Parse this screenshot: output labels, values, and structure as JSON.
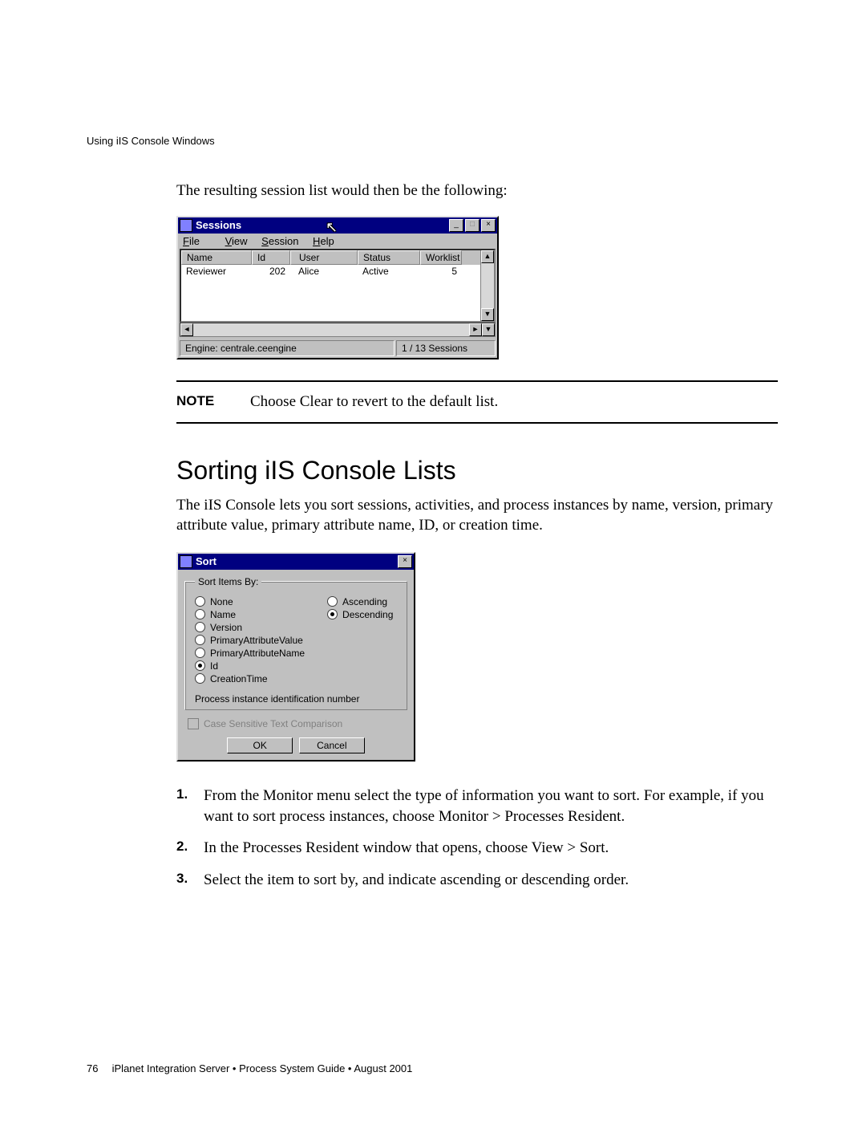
{
  "running_head": "Using iIS Console Windows",
  "intro1": "The resulting session list would then be the following:",
  "sessions_win": {
    "title": "Sessions",
    "menus": [
      "File",
      "View",
      "Session",
      "Help"
    ],
    "columns": [
      "Name",
      "Id",
      "User",
      "Status",
      "Worklist"
    ],
    "row": {
      "name": "Reviewer",
      "id": "202",
      "user": "Alice",
      "status": "Active",
      "worklist": "5"
    },
    "status_left": "Engine: centrale.ceengine",
    "status_right": "1 / 13 Sessions"
  },
  "note": {
    "label": "NOTE",
    "text": "Choose Clear to revert to the default list."
  },
  "section_title": "Sorting iIS Console Lists",
  "section_intro": "The iIS Console lets you sort sessions, activities, and process instances by name, version, primary attribute value, primary attribute name, ID, or creation time.",
  "sort_dlg": {
    "title": "Sort",
    "legend": "Sort Items By:",
    "fields": [
      "None",
      "Name",
      "Version",
      "PrimaryAttributeValue",
      "PrimaryAttributeName",
      "Id",
      "CreationTime"
    ],
    "selected_field": "Id",
    "order": [
      "Ascending",
      "Descending"
    ],
    "selected_order": "Descending",
    "desc": "Process instance identification number",
    "checkbox": "Case Sensitive Text Comparison",
    "ok": "OK",
    "cancel": "Cancel"
  },
  "steps": [
    "From the Monitor menu select the type of information you want to sort. For example, if you want to sort process instances, choose Monitor > Processes Resident.",
    "In the Processes Resident window that opens, choose View > Sort.",
    "Select the item to sort by, and indicate ascending or descending order."
  ],
  "footer": {
    "page": "76",
    "text": "iPlanet Integration Server • Process System Guide • August 2001"
  }
}
